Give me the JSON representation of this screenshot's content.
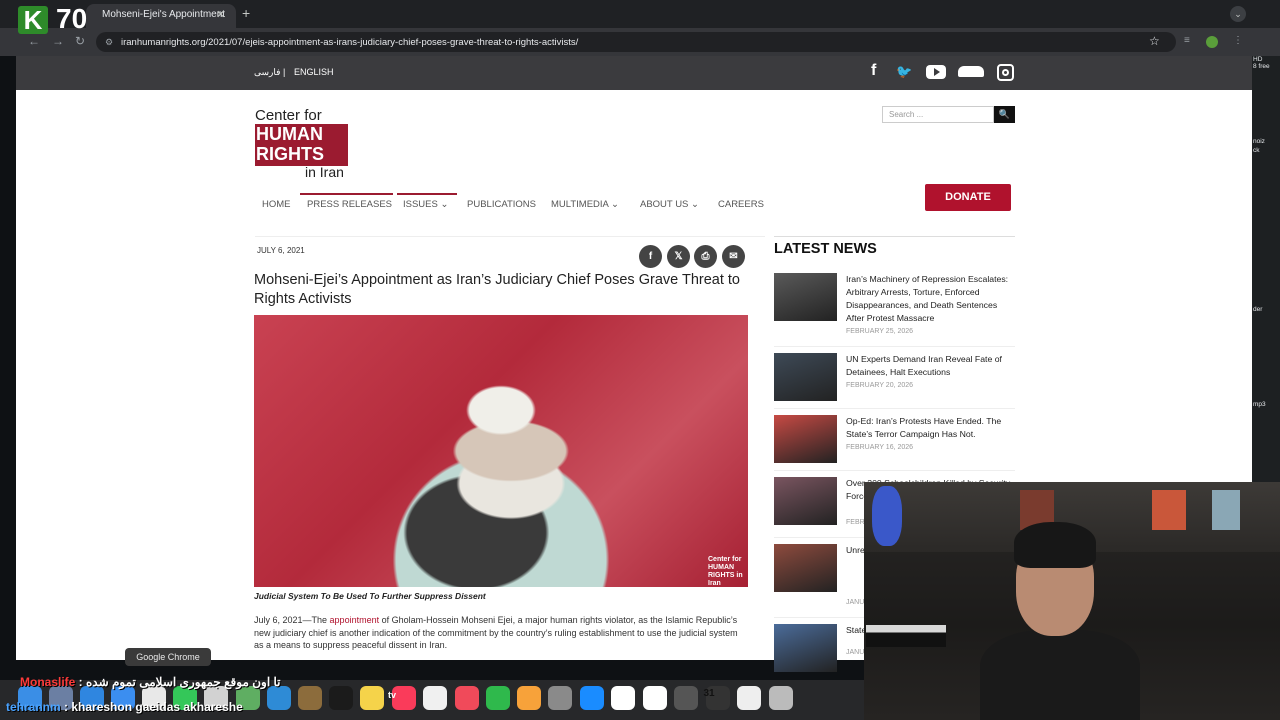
{
  "overlay": {
    "channel_badge": "K",
    "viewer_count": "70"
  },
  "browser": {
    "tab_title": "Mohseni-Ejei's Appointment",
    "url": "iranhumanrights.org/2021/07/ejeis-appointment-as-irans-judiciary-chief-poses-grave-threat-to-rights-activists/"
  },
  "topbar": {
    "lang_farsi": "فارسی",
    "lang_divider": "|",
    "lang_english": "ENGLISH",
    "social_icons": [
      "facebook-icon",
      "twitter-icon",
      "youtube-icon",
      "soundcloud-icon",
      "instagram-icon"
    ]
  },
  "logo": {
    "line1": "Center for",
    "line2": "HUMAN",
    "line3": "RIGHTS",
    "line4": "in Iran"
  },
  "search": {
    "placeholder": "Search ..."
  },
  "nav": {
    "items": [
      "HOME",
      "PRESS RELEASES",
      "ISSUES",
      "PUBLICATIONS",
      "MULTIMEDIA",
      "ABOUT US",
      "CAREERS"
    ],
    "donate": "DONATE"
  },
  "article": {
    "date": "JULY 6, 2021",
    "title": "Mohseni-Ejei’s Appointment as Iran’s Judiciary Chief Poses Grave Threat to Rights Activists",
    "image_watermark": "Center for HUMAN RIGHTS in Iran",
    "caption": "Judicial System To Be Used To Further Suppress Dissent",
    "body_prefix": "July 6, 2021—The ",
    "body_link": "appointment",
    "body_suffix": " of Gholam-Hossein Mohseni Ejei, a major human rights violator, as the Islamic Republic’s new judiciary chief is another indication of the commitment by the country’s ruling establishment to use the judicial system as a means to suppress peaceful dissent in Iran."
  },
  "latest_news": {
    "heading": "LATEST NEWS",
    "items": [
      {
        "title": "Iran’s Machinery of Repression Escalates: Arbitrary Arrests, Torture, Enforced Disappearances, and Death Sentences After Protest Massacre",
        "date": "FEBRUARY 25, 2026",
        "thumb_color": "#5a5a5a"
      },
      {
        "title": "UN Experts Demand Iran Reveal Fate of Detainees, Halt Executions",
        "date": "FEBRUARY 20, 2026",
        "thumb_color": "#3e4a57"
      },
      {
        "title": "Op-Ed: Iran’s Protests Have Ended. The State’s Terror Campaign Has Not.",
        "date": "FEBRUARY 16, 2026",
        "thumb_color": "#c74a44"
      },
      {
        "title": "Over 200 Schoolchildren Killed by Security Forces Effect",
        "date": "FEBR",
        "thumb_color": "#7a5560"
      },
      {
        "title": "Unre Deta Crac Prov",
        "date": "JANU",
        "thumb_color": "#8e4b3e"
      },
      {
        "title": "State “Bein",
        "date": "JANU",
        "thumb_color": "#4b6c9a"
      }
    ]
  },
  "right_sliver": {
    "texts": [
      "HD",
      "8 free",
      "noiz",
      "ck",
      "der",
      "mp3"
    ]
  },
  "dock": {
    "tooltip": "Google Chrome",
    "calendar_day": "31",
    "appletv_label": "tv"
  },
  "chat": [
    {
      "user": "Monaslife",
      "sep": " : ",
      "message": "تا اون موقع جمهوری اسلامی تموم شده"
    },
    {
      "user": "tehrannm",
      "sep": " : ",
      "message": "khareshon gaeidas akhareshe"
    }
  ]
}
